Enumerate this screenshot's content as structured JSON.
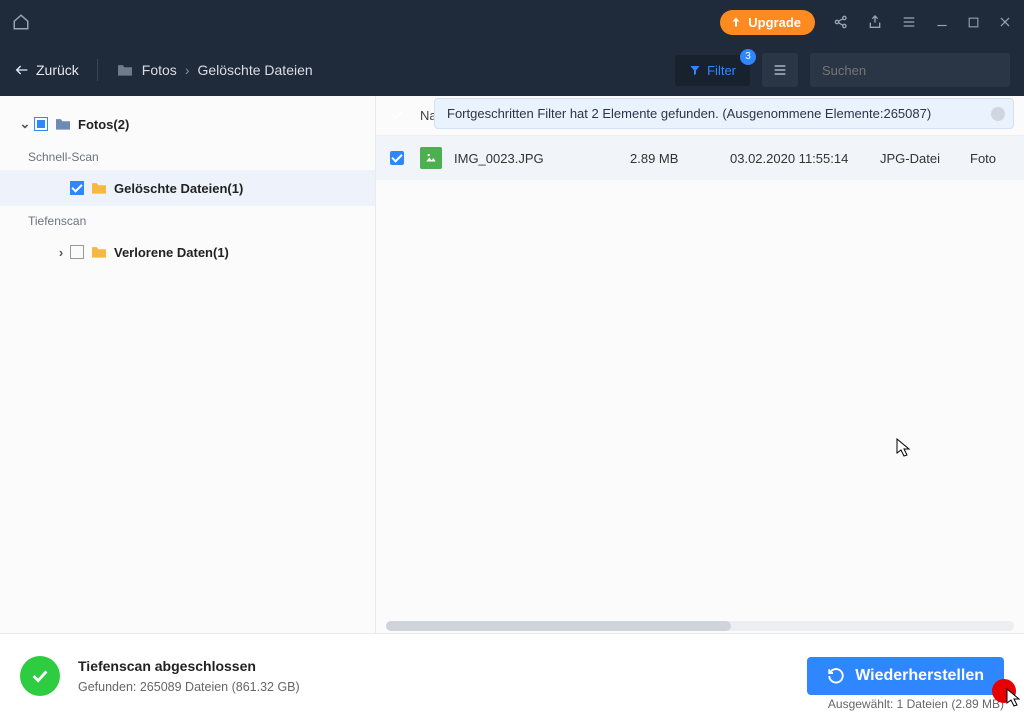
{
  "titlebar": {
    "upgrade": "Upgrade"
  },
  "toolbar": {
    "back": "Zurück",
    "crumb1": "Fotos",
    "crumb2": "Gelöschte Dateien",
    "filter_label": "Filter",
    "filter_count": "3",
    "search_placeholder": "Suchen"
  },
  "sidebar": {
    "root": "Fotos(2)",
    "section_quick": "Schnell-Scan",
    "deleted": "Gelöschte Dateien(1)",
    "section_deep": "Tiefenscan",
    "lost": "Verlorene Daten(1)"
  },
  "content": {
    "banner": "Fortgeschritten Filter hat 2 Elemente gefunden. (Ausgenommene Elemente:265087)",
    "header_name": "Na",
    "row": {
      "name": "IMG_0023.JPG",
      "size": "2.89 MB",
      "date": "03.02.2020 11:55:14",
      "type": "JPG-Datei",
      "path": "Foto"
    }
  },
  "footer": {
    "title": "Tiefenscan abgeschlossen",
    "found": "Gefunden: 265089 Dateien (861.32 GB)",
    "recover": "Wiederherstellen",
    "selected": "Ausgewählt: 1 Dateien (2.89 MB)"
  }
}
